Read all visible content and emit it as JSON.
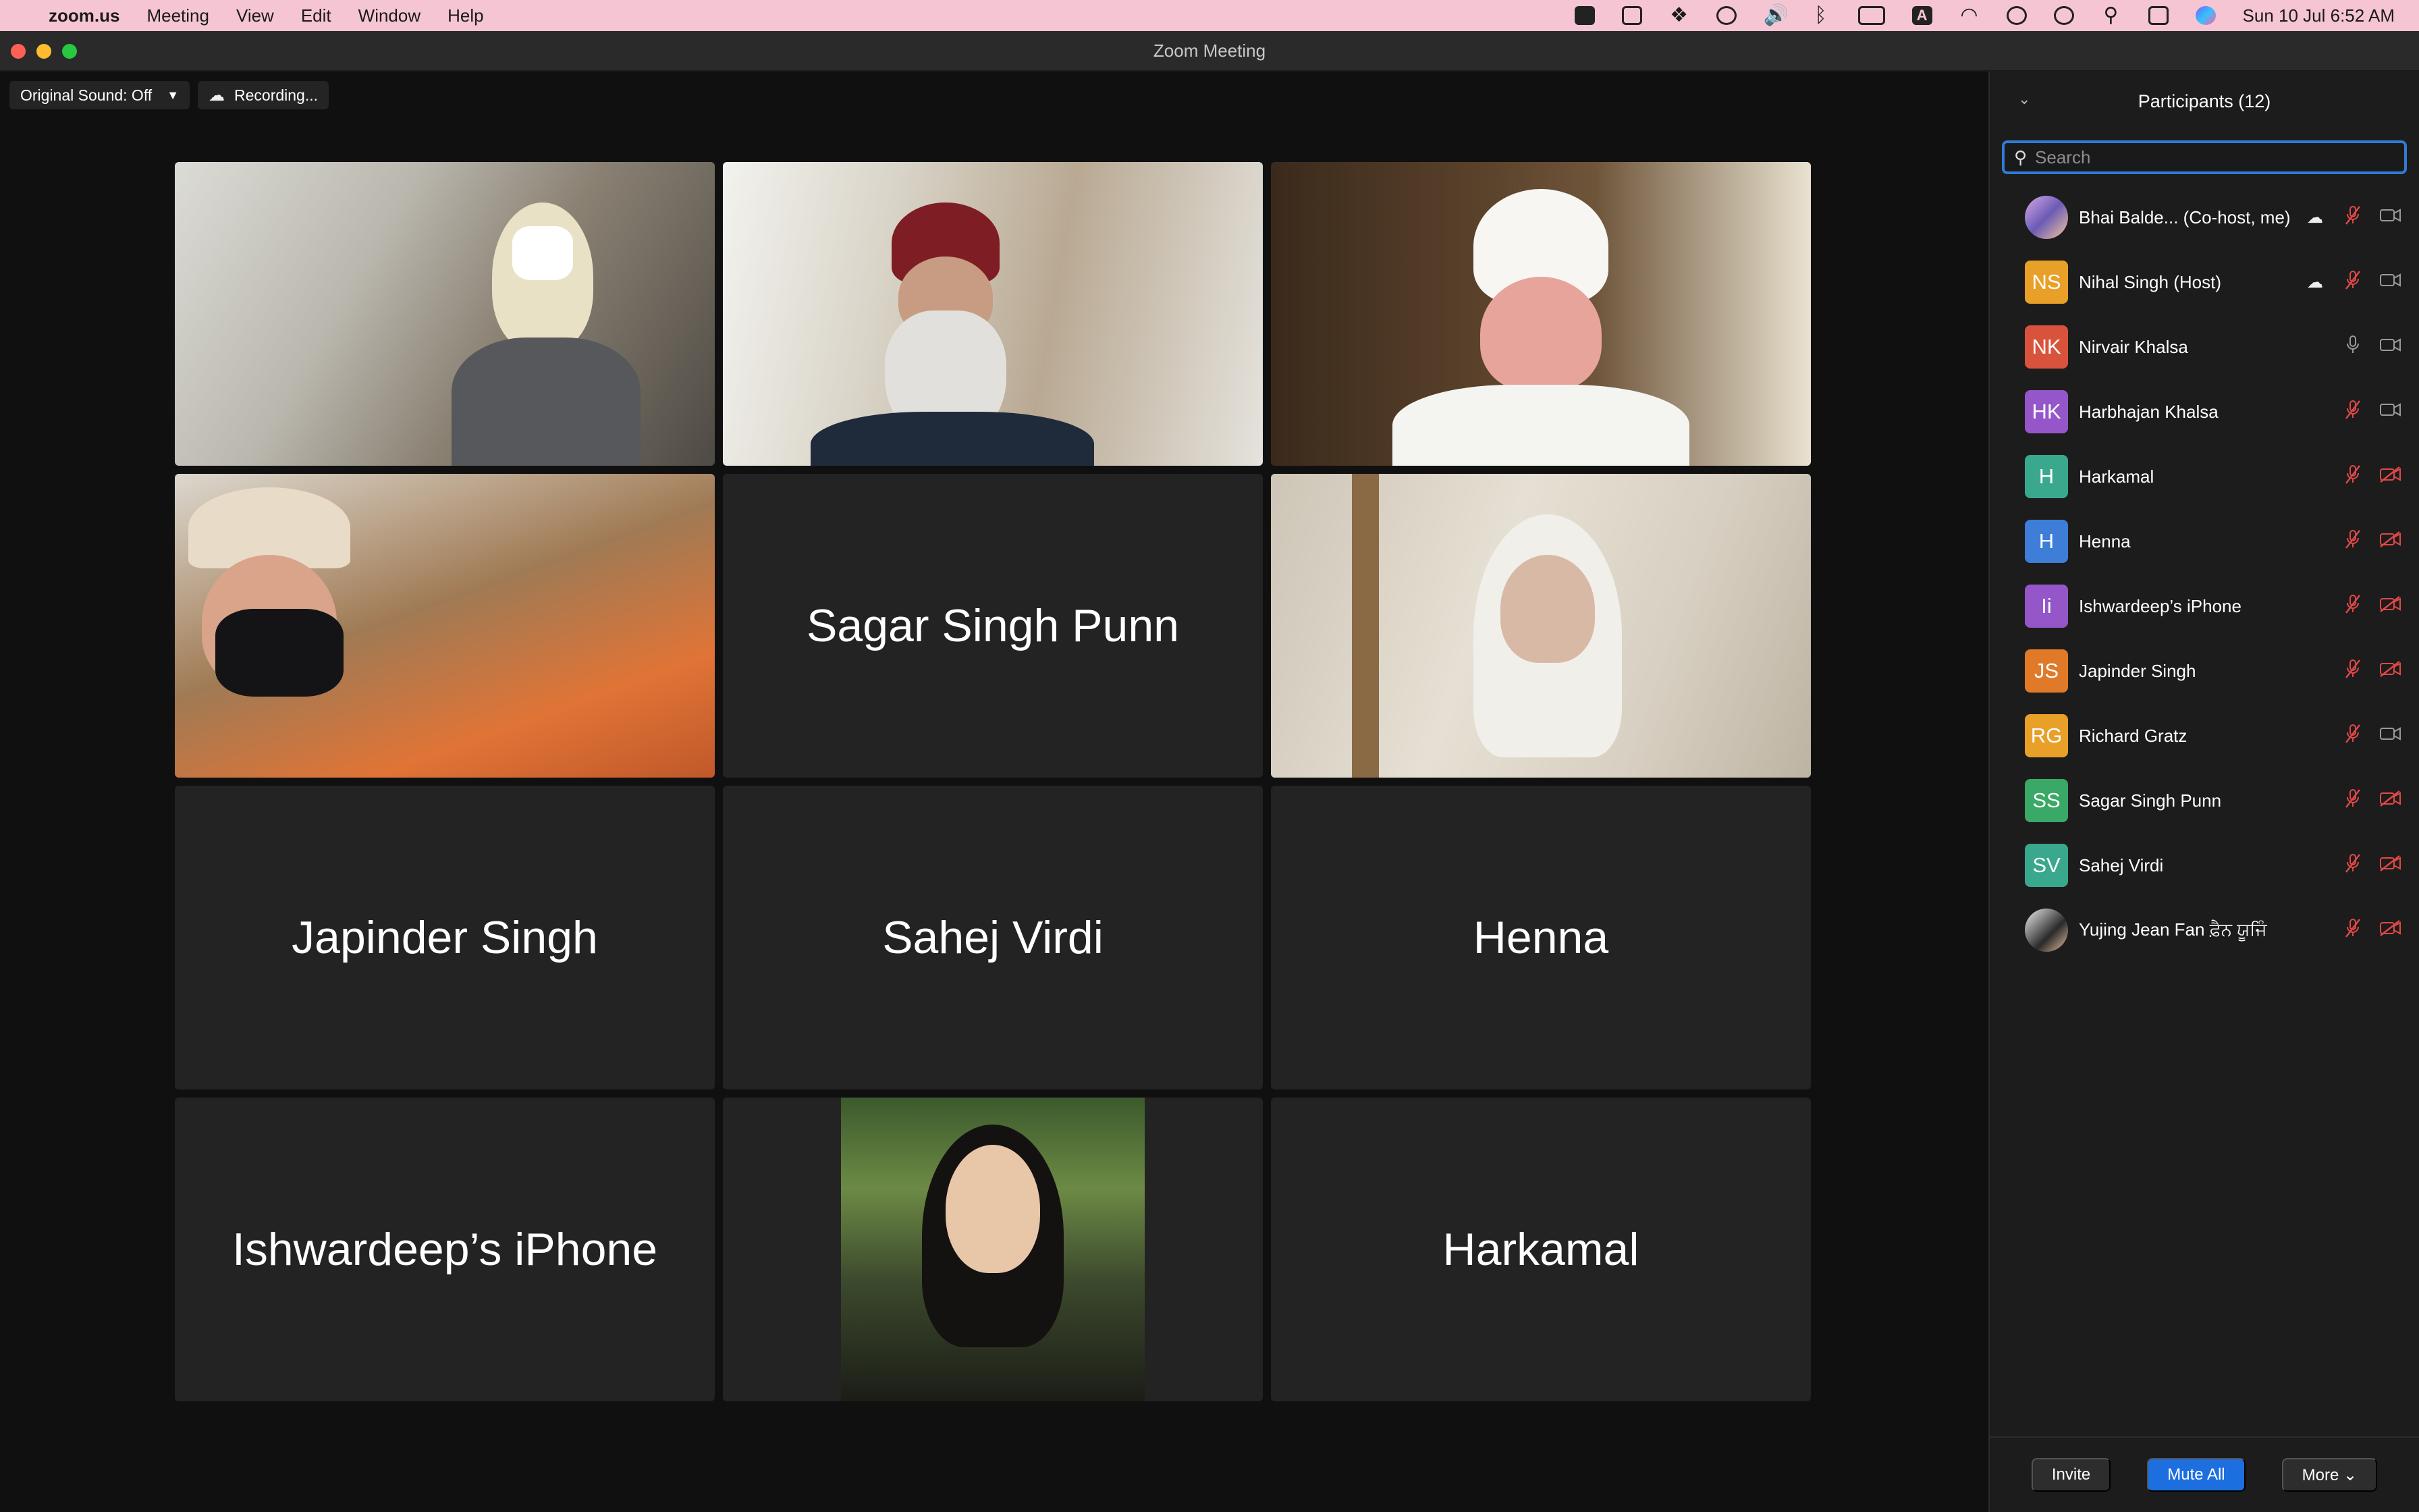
{
  "menubar": {
    "app_name": "zoom.us",
    "menus": [
      "Meeting",
      "View",
      "Edit",
      "Window",
      "Help"
    ],
    "clock": "Sun 10 Jul  6:52 AM",
    "keyboard_indicator": "A"
  },
  "window": {
    "title": "Zoom Meeting"
  },
  "controls": {
    "original_sound": "Original Sound: Off",
    "recording": "Recording..."
  },
  "tiles": [
    {
      "kind": "video",
      "name": ""
    },
    {
      "kind": "video",
      "name": ""
    },
    {
      "kind": "video",
      "name": ""
    },
    {
      "kind": "video",
      "name": ""
    },
    {
      "kind": "name",
      "name": "Sagar Singh Punn"
    },
    {
      "kind": "video",
      "name": "",
      "active": true
    },
    {
      "kind": "name",
      "name": "Japinder Singh"
    },
    {
      "kind": "name",
      "name": "Sahej Virdi"
    },
    {
      "kind": "name",
      "name": "Henna"
    },
    {
      "kind": "name",
      "name": "Ishwardeep’s iPhone"
    },
    {
      "kind": "photo",
      "name": ""
    },
    {
      "kind": "name",
      "name": "Harkamal"
    }
  ],
  "panel": {
    "title": "Participants (12)",
    "search_placeholder": "Search",
    "participants": [
      {
        "initials": "",
        "name": "Bhai Balde...  (Co-host, me)",
        "avatar_color": "",
        "cloud": true,
        "mic": "off",
        "cam": "on"
      },
      {
        "initials": "NS",
        "name": "Nihal Singh (Host)",
        "avatar_color": "#e8a028",
        "cloud": true,
        "mic": "off",
        "cam": "on"
      },
      {
        "initials": "NK",
        "name": "Nirvair Khalsa",
        "avatar_color": "#d9533c",
        "cloud": false,
        "mic": "on",
        "cam": "on"
      },
      {
        "initials": "HK",
        "name": "Harbhajan Khalsa",
        "avatar_color": "#9556c9",
        "cloud": false,
        "mic": "off",
        "cam": "on"
      },
      {
        "initials": "H",
        "name": "Harkamal",
        "avatar_color": "#3aa88c",
        "cloud": false,
        "mic": "off",
        "cam": "off"
      },
      {
        "initials": "H",
        "name": "Henna",
        "avatar_color": "#3e7dd8",
        "cloud": false,
        "mic": "off",
        "cam": "off"
      },
      {
        "initials": "Ii",
        "name": "Ishwardeep’s iPhone",
        "avatar_color": "#9556c9",
        "cloud": false,
        "mic": "off",
        "cam": "off"
      },
      {
        "initials": "JS",
        "name": "Japinder Singh",
        "avatar_color": "#e07a28",
        "cloud": false,
        "mic": "off",
        "cam": "off"
      },
      {
        "initials": "RG",
        "name": "Richard Gratz",
        "avatar_color": "#e8a028",
        "cloud": false,
        "mic": "off",
        "cam": "on"
      },
      {
        "initials": "SS",
        "name": "Sagar Singh Punn",
        "avatar_color": "#3aa866",
        "cloud": false,
        "mic": "off",
        "cam": "off"
      },
      {
        "initials": "SV",
        "name": "Sahej Virdi",
        "avatar_color": "#3aa88c",
        "cloud": false,
        "mic": "off",
        "cam": "off"
      },
      {
        "initials": "",
        "name": "Yujing Jean Fan ਫ਼ੈਨ ਯੂਜਿੰ",
        "avatar_color": "",
        "cloud": false,
        "mic": "off",
        "cam": "off"
      }
    ],
    "buttons": {
      "invite": "Invite",
      "mute_all": "Mute All",
      "more": "More ⌄"
    }
  }
}
